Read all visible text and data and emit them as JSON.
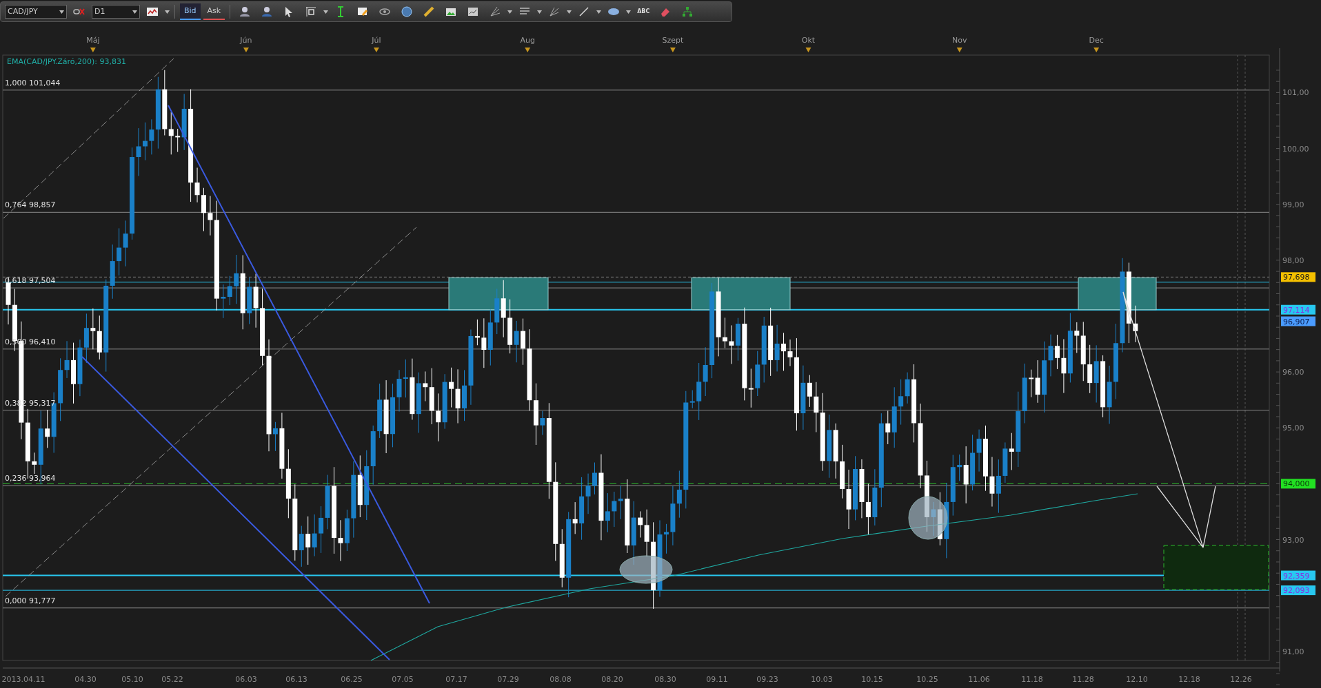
{
  "toolbar": {
    "symbol": "CAD/JPY",
    "timeframe": "D1",
    "price_tabs": [
      {
        "label": "Bid",
        "selected": true
      },
      {
        "label": "Ask",
        "selected": false
      }
    ],
    "text_tool_label": "ABC"
  },
  "months": [
    "Máj",
    "Jún",
    "Júl",
    "Aug",
    "Szept",
    "Okt",
    "Nov",
    "Dec"
  ],
  "indicator_legend": "EMA(CAD/JPY.Záró,200): 93,831",
  "fib_levels": [
    "1,000 101,044",
    "0,764 98,857",
    "0,618 97,504",
    "0,500 96,410",
    "0,382 95,317",
    "0,236 93,964",
    "0,000 91,777"
  ],
  "price_axis": [
    "101,00",
    "100,00",
    "99,00",
    "98,00",
    "96,00",
    "95,00",
    "93,00",
    "91,00"
  ],
  "price_labels": [
    {
      "text": "97,698",
      "color": "#f5c000"
    },
    {
      "text": "97,114",
      "color": "#28c8f0"
    },
    {
      "text": "96,907",
      "color": "#4a9cff"
    },
    {
      "text": "94,000",
      "color": "#22e022"
    },
    {
      "text": "92,359",
      "color": "#28c8f0"
    },
    {
      "text": "92,093",
      "color": "#28c8f0"
    }
  ],
  "date_axis": [
    "2013.04.11",
    "04.30",
    "05.10",
    "05.22",
    "06.03",
    "06.13",
    "06.25",
    "07.05",
    "07.17",
    "07.29",
    "08.08",
    "08.20",
    "08.30",
    "09.11",
    "09.23",
    "10.03",
    "10.15",
    "10.25",
    "11.06",
    "11.18",
    "11.28",
    "12.10",
    "12.18",
    "12.26"
  ]
}
